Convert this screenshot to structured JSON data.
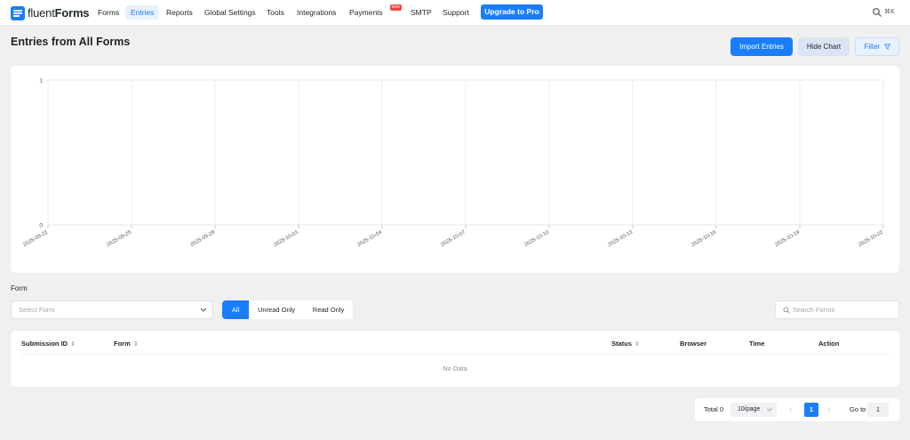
{
  "brand": {
    "name_light": "fluent",
    "name_bold": "Forms"
  },
  "nav": {
    "items": [
      {
        "label": "Forms"
      },
      {
        "label": "Entries",
        "active": true
      },
      {
        "label": "Reports"
      },
      {
        "label": "Global Settings"
      },
      {
        "label": "Tools"
      },
      {
        "label": "Integrations"
      },
      {
        "label": "Payments",
        "badge": "new"
      },
      {
        "label": "SMTP"
      },
      {
        "label": "Support"
      }
    ],
    "upgrade_label": "Upgrade to Pro",
    "shortcut": "⌘K"
  },
  "page": {
    "title": "Entries from All Forms",
    "import_label": "Import Entries",
    "hide_chart_label": "Hide Chart",
    "filter_label": "Filter"
  },
  "chart_data": {
    "type": "line",
    "x": [
      "2025-09-22",
      "2025-09-25",
      "2025-09-28",
      "2025-10-01",
      "2025-10-04",
      "2025-10-07",
      "2025-10-10",
      "2025-10-13",
      "2025-10-16",
      "2025-10-19",
      "2025-10-22"
    ],
    "series": [
      {
        "values": [
          0,
          0,
          0,
          0,
          0,
          0,
          0,
          0,
          0,
          0,
          0
        ]
      }
    ],
    "y_ticks": [
      "0",
      "1"
    ],
    "ylim": [
      0,
      1
    ],
    "grid": true
  },
  "filters": {
    "form_label": "Form",
    "select_placeholder": "Select Form",
    "segments": [
      "All",
      "Unread Only",
      "Read Only"
    ],
    "selected_segment": "All",
    "search_placeholder": "Search Forms"
  },
  "table": {
    "columns": [
      "Submission ID",
      "Form",
      "Status",
      "Browser",
      "Time",
      "Action"
    ],
    "empty_text": "No Data"
  },
  "pagination": {
    "total": "Total 0",
    "page_size": "10/page",
    "current_page": "1",
    "goto_label": "Go to",
    "goto_value": "1"
  },
  "colors": {
    "accent": "#1a7efb",
    "background": "#f0f0f1"
  }
}
